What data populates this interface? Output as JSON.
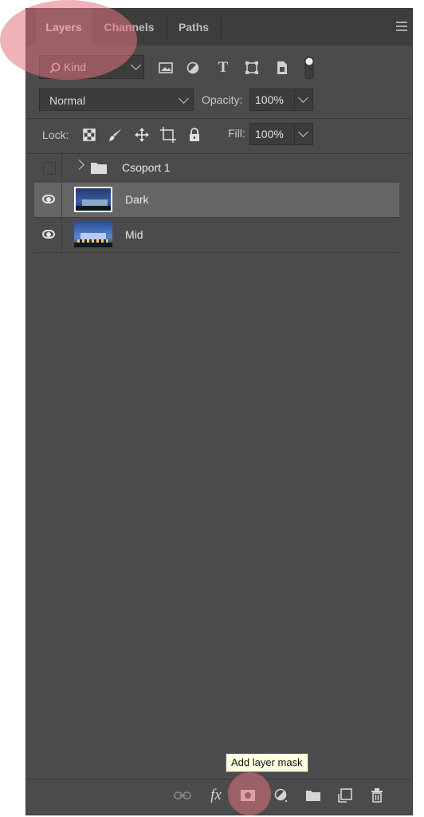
{
  "tabs": [
    {
      "label": "Layers",
      "active": true
    },
    {
      "label": "Channels",
      "active": false
    },
    {
      "label": "Paths",
      "active": false
    }
  ],
  "filter": {
    "kind_label": "Kind",
    "icons": [
      "image-filter-icon",
      "adjustment-filter-icon",
      "type-filter-icon",
      "shape-filter-icon",
      "smart-object-filter-icon",
      "filter-toggle-icon"
    ]
  },
  "blend": {
    "mode": "Normal",
    "opacity_label": "Opacity:",
    "opacity_value": "100%"
  },
  "lock": {
    "label": "Lock:",
    "fill_label": "Fill:",
    "fill_value": "100%",
    "icons": [
      "lock-transparent-pixels-icon",
      "lock-image-pixels-icon",
      "lock-position-icon",
      "lock-artboard-icon",
      "lock-all-icon"
    ]
  },
  "layers": [
    {
      "name": "Csoport 1",
      "type": "group",
      "visible": false,
      "selected": false
    },
    {
      "name": "Dark",
      "type": "image",
      "visible": true,
      "selected": true
    },
    {
      "name": "Mid",
      "type": "image",
      "visible": true,
      "selected": false
    }
  ],
  "bottom_icons": [
    "link-layers-icon",
    "layer-style-fx-icon",
    "add-layer-mask-icon",
    "adjustment-layer-icon",
    "new-group-icon",
    "new-layer-icon",
    "delete-layer-icon"
  ],
  "tooltip": "Add layer mask",
  "colors": {
    "panel": "#4b4b4b",
    "tabbar": "#3d3d3d",
    "selected_row": "#666666",
    "highlight": "#e2737d"
  }
}
